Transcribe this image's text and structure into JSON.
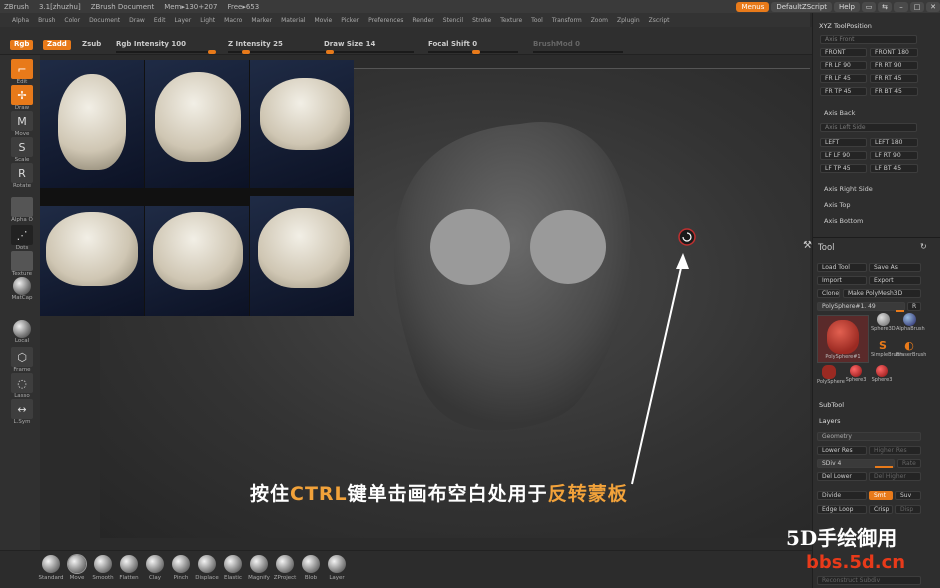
{
  "titlebar": {
    "app": "ZBrush",
    "version": "3.1[zhuzhu]",
    "doc": "ZBrush Document",
    "mem": "Mem▸130+207",
    "free": "Free▸653",
    "menus": "Menus",
    "script": "DefaultZScript",
    "help": "Help"
  },
  "menu": [
    "Alpha",
    "Brush",
    "Color",
    "Document",
    "Draw",
    "Edit",
    "Layer",
    "Light",
    "Macro",
    "Marker",
    "Material",
    "Movie",
    "Picker",
    "Preferences",
    "Render",
    "Stencil",
    "Stroke",
    "Texture",
    "Tool",
    "Transform",
    "Zoom",
    "Zplugin",
    "Zscript"
  ],
  "shelf": {
    "rgb": "Rgb",
    "zadd": "Zadd",
    "zsub": "Zsub",
    "rgb_intensity": "Rgb Intensity 100",
    "z_intensity": "Z Intensity 25",
    "draw_size": "Draw Size 14",
    "focal_shift": "Focal Shift 0",
    "brushmod": "BrushMod 0"
  },
  "left": {
    "edit": "Edit",
    "draw": "Draw",
    "move": "Move",
    "scale": "Scale",
    "rotate": "Rotate",
    "alpha": "Alpha  O",
    "dots": "Dots",
    "texture": "Texture",
    "matcap": "MatCap",
    "local": "Local",
    "frame": "Frame",
    "lasso": "Lasso",
    "lsym": "L.Sym"
  },
  "right": {
    "xyz_title": "XYZ ToolPosition",
    "axis_front": "Axis Front",
    "front": "FRONT",
    "front180": "FRONT 180",
    "frlf90": "FR LF 90",
    "frrt90": "FR RT 90",
    "frlf45": "FR LF 45",
    "frrt45": "FR RT 45",
    "frtp45": "FR TP 45",
    "frbt45": "FR BT 45",
    "axis_back": "Axis Back",
    "axis_left_side": "Axis Left Side",
    "left": "LEFT",
    "left180": "LEFT 180",
    "lflf90": "LF LF 90",
    "lfrt90": "LF RT 90",
    "lftp45": "LF TP 45",
    "lfbt45": "LF BT 45",
    "axis_right_side": "Axis Right Side",
    "axis_top": "Axis Top",
    "axis_bottom": "Axis Bottom",
    "tool_title": "Tool",
    "load_tool": "Load Tool",
    "save_as": "Save As",
    "import": "Import",
    "export": "Export",
    "clone": "Clone",
    "make_polymesh": "Make PolyMesh3D",
    "current_tool": "PolySphere#1. 49",
    "r": "R",
    "thumbs": [
      "PolySphere#1",
      "Sphere3D",
      "AlphaBrush",
      "SimpleBrush",
      "EraserBrush",
      "PolySphere",
      "Sphere3",
      "Sphere3"
    ],
    "subtool": "SubTool",
    "layers": "Layers",
    "geometry": "Geometry",
    "lower_res": "Lower Res",
    "higher_res": "Higher Res",
    "sdiv": "SDiv 4",
    "rate": "Rate",
    "del_lower": "Del Lower",
    "del_higher": "Del Higher",
    "divide": "Divide",
    "smt": "Smt",
    "suv": "Suv",
    "edge_loop": "Edge Loop",
    "crisp": "Crisp",
    "disp": "Disp",
    "reconstruct": "Reconstruct Subdiv"
  },
  "brushes": [
    "Standard",
    "Move",
    "Smooth",
    "Flatten",
    "Clay",
    "Pinch",
    "Displace",
    "Elastic",
    "Magnify",
    "ZProject",
    "Blob",
    "Layer"
  ],
  "caption": {
    "pre": "按住",
    "key": "CTRL",
    "mid": "键单击画布空白处用于",
    "end": "反转蒙板"
  },
  "watermark": {
    "line1": "5D手绘御用",
    "line2": "bbs.5d.cn"
  }
}
